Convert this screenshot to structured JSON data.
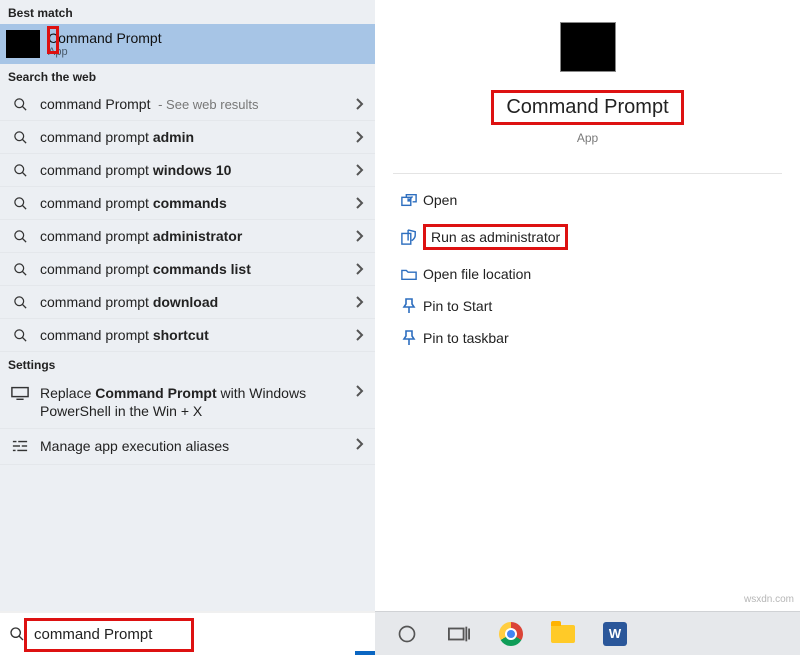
{
  "left": {
    "best_match_label": "Best match",
    "best_match": {
      "title": "Command Prompt",
      "subtitle": "App"
    },
    "web_label": "Search the web",
    "web_results": [
      {
        "prefix": "command Prompt",
        "bold": "",
        "hint": " - See web results"
      },
      {
        "prefix": "command prompt ",
        "bold": "admin",
        "hint": ""
      },
      {
        "prefix": "command prompt ",
        "bold": "windows 10",
        "hint": ""
      },
      {
        "prefix": "command prompt ",
        "bold": "commands",
        "hint": ""
      },
      {
        "prefix": "command prompt ",
        "bold": "administrator",
        "hint": ""
      },
      {
        "prefix": "command prompt ",
        "bold": "commands list",
        "hint": ""
      },
      {
        "prefix": "command prompt ",
        "bold": "download",
        "hint": ""
      },
      {
        "prefix": "command prompt ",
        "bold": "shortcut",
        "hint": ""
      }
    ],
    "settings_label": "Settings",
    "settings": [
      {
        "prefix": "Replace ",
        "bold": "Command Prompt",
        "suffix": " with Windows PowerShell in the Win + X"
      },
      {
        "prefix": "Manage app execution aliases",
        "bold": "",
        "suffix": ""
      }
    ],
    "search_value": "command Prompt"
  },
  "right": {
    "title": "Command Prompt",
    "subtitle": "App",
    "actions": [
      {
        "key": "open",
        "label": "Open",
        "icon": "open"
      },
      {
        "key": "run-admin",
        "label": "Run as administrator",
        "icon": "shield"
      },
      {
        "key": "open-location",
        "label": "Open file location",
        "icon": "folder"
      },
      {
        "key": "pin-start",
        "label": "Pin to Start",
        "icon": "pin"
      },
      {
        "key": "pin-taskbar",
        "label": "Pin to taskbar",
        "icon": "pin"
      }
    ]
  },
  "watermark": "wsxdn.com",
  "taskbar": {
    "word_glyph": "W"
  }
}
